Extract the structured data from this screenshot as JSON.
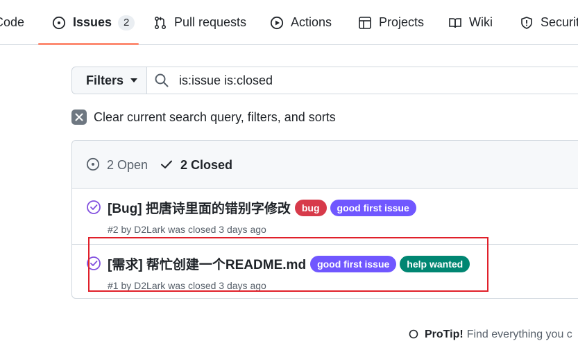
{
  "nav": {
    "tabs": [
      {
        "label": "Code",
        "icon": "code-icon"
      },
      {
        "label": "Issues",
        "icon": "issue-opened-icon",
        "count": "2"
      },
      {
        "label": "Pull requests",
        "icon": "git-pull-request-icon"
      },
      {
        "label": "Actions",
        "icon": "play-icon"
      },
      {
        "label": "Projects",
        "icon": "table-icon"
      },
      {
        "label": "Wiki",
        "icon": "book-icon"
      },
      {
        "label": "Security",
        "icon": "shield-icon"
      }
    ],
    "active_tab": "Issues"
  },
  "filter": {
    "filters_label": "Filters",
    "search_value": "is:issue is:closed"
  },
  "clear": {
    "label": "Clear current search query, filters, and sorts"
  },
  "list": {
    "open_label": "2 Open",
    "closed_label": "2 Closed",
    "issues": [
      {
        "title": "[Bug] 把唐诗里面的错别字修改",
        "labels": [
          {
            "text": "bug",
            "color": "#d73a4a"
          },
          {
            "text": "good first issue",
            "color": "#7057ff"
          }
        ],
        "meta": "#2 by D2Lark was closed 3 days ago"
      },
      {
        "title": "[需求] 帮忙创建一个README.md",
        "labels": [
          {
            "text": "good first issue",
            "color": "#7057ff"
          },
          {
            "text": "help wanted",
            "color": "#008672"
          }
        ],
        "meta": "#1 by D2Lark was closed 3 days ago"
      }
    ]
  },
  "protip": {
    "label": "ProTip!",
    "text": "Find everything you c"
  },
  "colors": {
    "accent": "#fd8c73",
    "closed_icon": "#8250df",
    "highlight": "#e0202a"
  }
}
